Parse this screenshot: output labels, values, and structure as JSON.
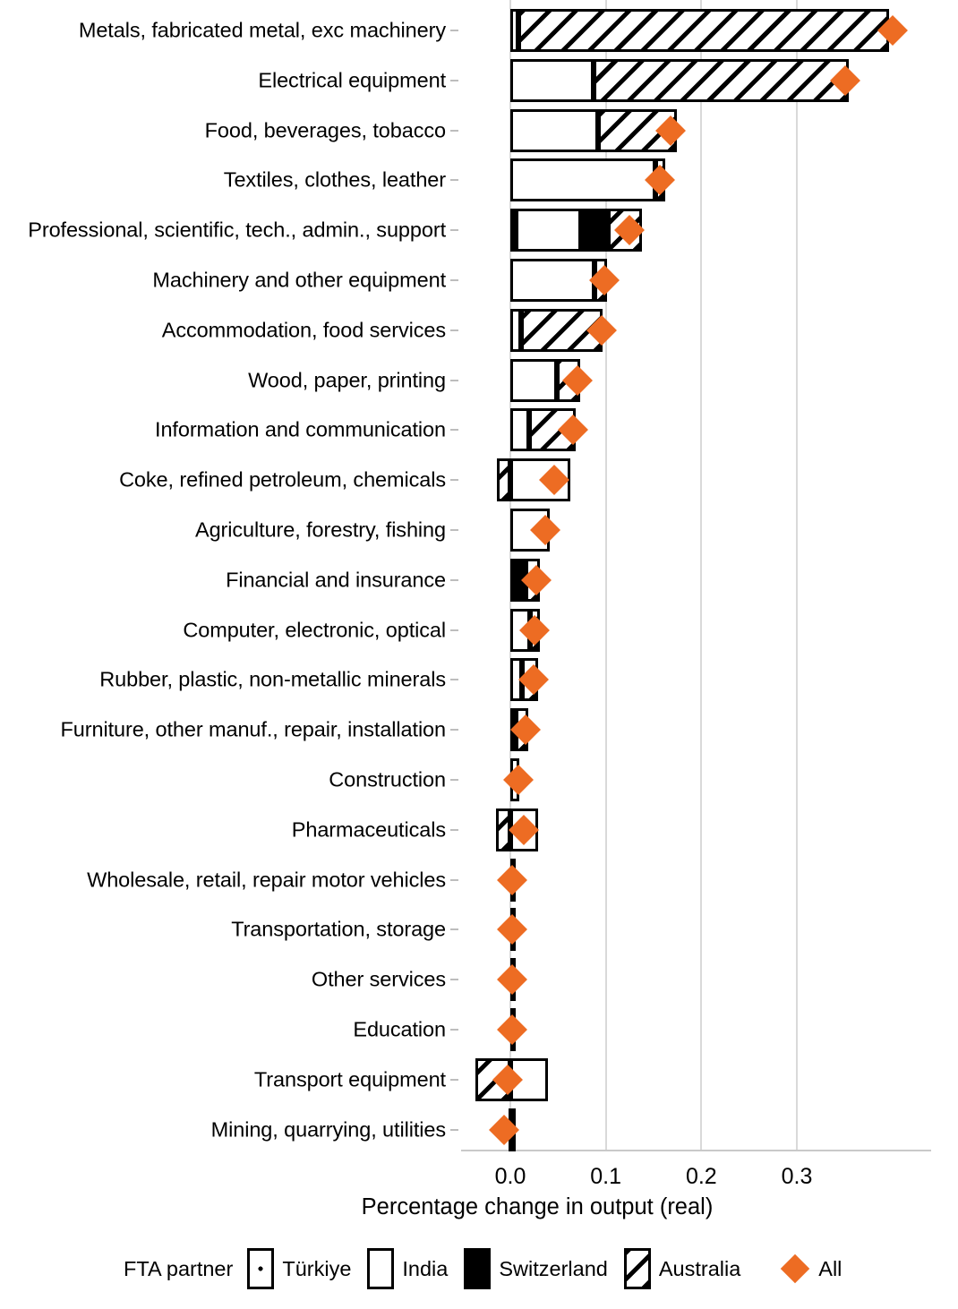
{
  "axis": {
    "xlabel": "Percentage change in output (real)",
    "xticks": [
      "0.0",
      "0.1",
      "0.2",
      "0.3"
    ]
  },
  "legend": {
    "title": "FTA  partner",
    "items": [
      {
        "label": "Türkiye",
        "key": "turkiye"
      },
      {
        "label": "India",
        "key": "india"
      },
      {
        "label": "Switzerland",
        "key": "swiss"
      },
      {
        "label": "Australia",
        "key": "aus"
      },
      {
        "label": "All",
        "key": "all",
        "color": "#ED6C23"
      }
    ]
  },
  "chart_data": {
    "type": "bar",
    "orientation": "horizontal",
    "stacked": true,
    "title": "",
    "xlabel": "Percentage change in output (real)",
    "ylabel": "",
    "xlim": [
      -0.045,
      0.41
    ],
    "xticks": [
      0.0,
      0.1,
      0.2,
      0.3
    ],
    "grid": "vertical",
    "legend_position": "bottom",
    "series": [
      "Türkiye",
      "India",
      "Switzerland",
      "Australia"
    ],
    "marker_series": "All",
    "categories": [
      "Metals, fabricated metal, exc machinery",
      "Electrical equipment",
      "Food, beverages, tobacco",
      "Textiles, clothes, leather",
      "Professional, scientific, tech., admin., support",
      "Machinery and other equipment",
      "Accommodation, food services",
      "Wood, paper, printing",
      "Information and communication",
      "Coke, refined petroleum, chemicals",
      "Agriculture, forestry, fishing",
      "Financial and insurance",
      "Computer, electronic, optical",
      "Rubber, plastic, non-metallic minerals",
      "Furniture, other manuf., repair, installation",
      "Construction",
      "Pharmaceuticals",
      "Wholesale, retail, repair motor vehicles",
      "Transportation, storage",
      "Other services",
      "Education",
      "Transport equipment",
      "Mining, quarrying, utilities"
    ],
    "rows": [
      {
        "category": "Metals, fabricated metal, exc machinery",
        "turkiye": 0.0,
        "india": 0.008,
        "switzerland": 0.0,
        "australia": 0.389,
        "all": 0.4
      },
      {
        "category": "Electrical equipment",
        "turkiye": 0.0,
        "india": 0.087,
        "switzerland": 0.0,
        "australia": 0.267,
        "all": 0.351
      },
      {
        "category": "Food, beverages, tobacco",
        "turkiye": 0.0,
        "india": 0.092,
        "switzerland": 0.0,
        "australia": 0.082,
        "all": 0.168
      },
      {
        "category": "Textiles, clothes, leather",
        "turkiye": 0.0,
        "india": 0.152,
        "switzerland": 0.0,
        "australia": 0.01,
        "all": 0.157
      },
      {
        "category": "Professional, scientific, tech., admin., support",
        "turkiye": 0.006,
        "india": 0.068,
        "switzerland": 0.028,
        "australia": 0.036,
        "all": 0.125
      },
      {
        "category": "Machinery and other equipment",
        "turkiye": 0.0,
        "india": 0.088,
        "switzerland": 0.0,
        "australia": 0.013,
        "all": 0.098
      },
      {
        "category": "Accommodation, food services",
        "turkiye": 0.0,
        "india": 0.011,
        "switzerland": 0.0,
        "australia": 0.086,
        "all": 0.096
      },
      {
        "category": "Wood, paper, printing",
        "turkiye": 0.0,
        "india": 0.049,
        "switzerland": 0.0,
        "australia": 0.024,
        "all": 0.07
      },
      {
        "category": "Information and communication",
        "turkiye": 0.0,
        "india": 0.02,
        "switzerland": 0.0,
        "australia": 0.048,
        "all": 0.066
      },
      {
        "category": "Coke, refined petroleum, chemicals",
        "turkiye": 0.0,
        "india": 0.063,
        "switzerland": 0.0,
        "australia": -0.014,
        "all": 0.046
      },
      {
        "category": "Agriculture, forestry, fishing",
        "turkiye": 0.0,
        "india": 0.041,
        "switzerland": 0.0,
        "australia": 0.0,
        "all": 0.037
      },
      {
        "category": "Financial and insurance",
        "turkiye": 0.0,
        "india": 0.0,
        "switzerland": 0.016,
        "australia": 0.015,
        "all": 0.027
      },
      {
        "category": "Computer, electronic, optical",
        "turkiye": 0.0,
        "india": 0.021,
        "switzerland": 0.0,
        "australia": 0.01,
        "all": 0.025
      },
      {
        "category": "Rubber, plastic, non-metallic minerals",
        "turkiye": 0.0,
        "india": 0.012,
        "switzerland": 0.0,
        "australia": 0.017,
        "all": 0.024
      },
      {
        "category": "Furniture, other manuf., repair, installation",
        "turkiye": 0.0,
        "india": 0.006,
        "switzerland": 0.0,
        "australia": 0.013,
        "all": 0.016
      },
      {
        "category": "Construction",
        "turkiye": 0.0,
        "india": 0.009,
        "switzerland": 0.0,
        "australia": 0.0,
        "all": 0.008
      },
      {
        "category": "Pharmaceuticals",
        "turkiye": 0.0,
        "india": 0.029,
        "switzerland": 0.0,
        "australia": -0.015,
        "all": 0.014
      },
      {
        "category": "Wholesale, retail, repair motor vehicles",
        "turkiye": 0.0,
        "india": 0.0,
        "switzerland": 0.002,
        "australia": 0.0,
        "all": 0.002
      },
      {
        "category": "Transportation, storage",
        "turkiye": 0.0,
        "india": 0.0,
        "switzerland": 0.002,
        "australia": 0.0,
        "all": 0.002
      },
      {
        "category": "Other services",
        "turkiye": 0.0,
        "india": 0.001,
        "switzerland": 0.0,
        "australia": 0.0,
        "all": 0.002
      },
      {
        "category": "Education",
        "turkiye": 0.0,
        "india": 0.001,
        "switzerland": 0.0,
        "australia": 0.0,
        "all": 0.002
      },
      {
        "category": "Transport equipment",
        "turkiye": 0.0,
        "india": 0.039,
        "switzerland": 0.0,
        "australia": -0.037,
        "all": -0.003
      },
      {
        "category": "Mining, quarrying, utilities",
        "turkiye": 0.0,
        "india": 0.001,
        "switzerland": 0.0,
        "australia": -0.002,
        "all": -0.007
      }
    ]
  }
}
